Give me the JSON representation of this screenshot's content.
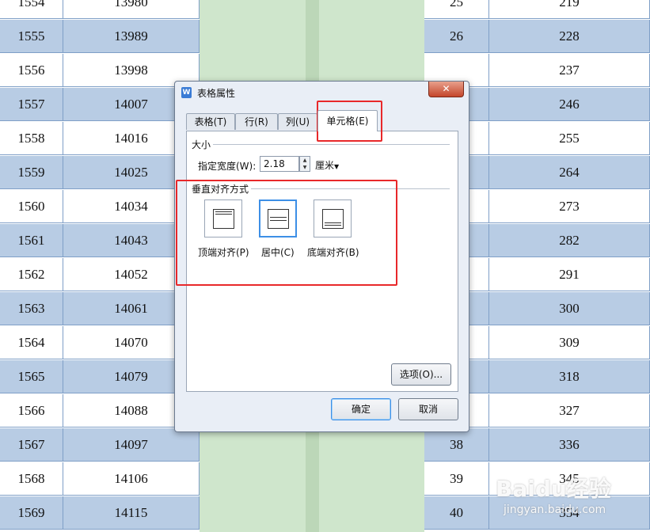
{
  "sheet": {
    "left_rows": [
      [
        "1554",
        "13980"
      ],
      [
        "1555",
        "13989"
      ],
      [
        "1556",
        "13998"
      ],
      [
        "1557",
        "14007"
      ],
      [
        "1558",
        "14016"
      ],
      [
        "1559",
        "14025"
      ],
      [
        "1560",
        "14034"
      ],
      [
        "1561",
        "14043"
      ],
      [
        "1562",
        "14052"
      ],
      [
        "1563",
        "14061"
      ],
      [
        "1564",
        "14070"
      ],
      [
        "1565",
        "14079"
      ],
      [
        "1566",
        "14088"
      ],
      [
        "1567",
        "14097"
      ],
      [
        "1568",
        "14106"
      ],
      [
        "1569",
        "14115"
      ]
    ],
    "right_rows": [
      [
        "25",
        "219"
      ],
      [
        "26",
        "228"
      ],
      [
        "",
        "237"
      ],
      [
        "",
        "246"
      ],
      [
        "",
        "255"
      ],
      [
        "",
        "264"
      ],
      [
        "",
        "273"
      ],
      [
        "",
        "282"
      ],
      [
        "",
        "291"
      ],
      [
        "",
        "300"
      ],
      [
        "",
        "309"
      ],
      [
        "",
        "318"
      ],
      [
        "",
        "327"
      ],
      [
        "38",
        "336"
      ],
      [
        "39",
        "345"
      ],
      [
        "40",
        "354"
      ]
    ]
  },
  "dialog": {
    "title": "表格属性",
    "app_icon_text": "W",
    "close_label": "✕",
    "tabs": [
      {
        "label": "表格(T)"
      },
      {
        "label": "行(R)"
      },
      {
        "label": "列(U)"
      },
      {
        "label": "单元格(E)",
        "active": true
      }
    ],
    "size_section": {
      "label": "大小",
      "width_label": "指定宽度(W):",
      "width_value": "2.18",
      "unit": "厘米"
    },
    "valign_section": {
      "label": "垂直对齐方式",
      "options": [
        {
          "label": "顶端对齐(P)",
          "icon": "align-top-icon"
        },
        {
          "label": "居中(C)",
          "icon": "align-center-icon",
          "selected": true
        },
        {
          "label": "底端对齐(B)",
          "icon": "align-bottom-icon"
        }
      ]
    },
    "options_button": "选项(O)...",
    "ok_button": "确定",
    "cancel_button": "取消"
  },
  "watermark": {
    "brand": "Baidu经验",
    "url": "jingyan.baidu.com"
  },
  "colors": {
    "row_shade": "#b8cce4",
    "green_band": "#cfe6cc",
    "highlight_red": "#e8282a",
    "selection_blue": "#3d8fe6"
  }
}
